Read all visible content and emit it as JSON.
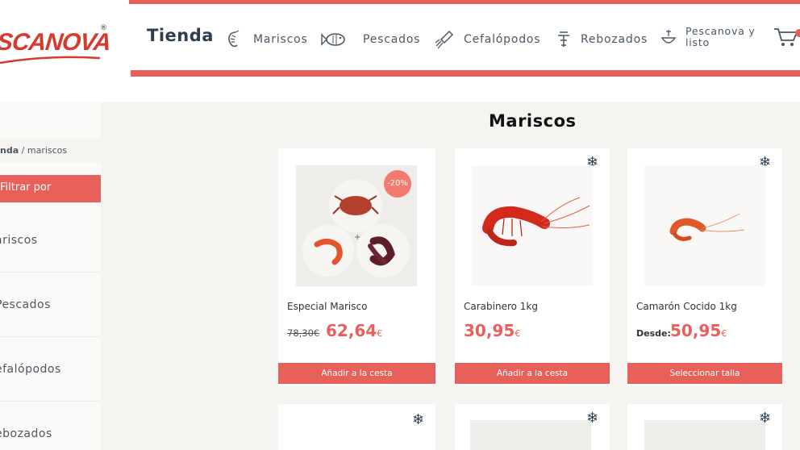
{
  "brand": {
    "logo_text": "SCANOVA",
    "reg": "®"
  },
  "nav": {
    "title": "Tienda",
    "items": [
      {
        "label": "Mariscos",
        "icon": "shrimp-icon"
      },
      {
        "label": "Pescados",
        "icon": "fish-icon"
      },
      {
        "label": "Cefalópodos",
        "icon": "squid-icon"
      },
      {
        "label": "Rebozados",
        "icon": "fried-food-icon"
      },
      {
        "label_line1": "Pescanova y",
        "label_line2": "listo",
        "icon": "dish-icon"
      }
    ],
    "cart_icon": "cart-icon"
  },
  "breadcrumb": {
    "home": "nda",
    "separator": "/",
    "current": "mariscos"
  },
  "filter": {
    "label": "Filtrar por"
  },
  "sidebar": {
    "items": [
      {
        "label": "ariscos"
      },
      {
        "label": "Pescados"
      },
      {
        "label": "efalópodos"
      },
      {
        "label": "ebozados"
      }
    ]
  },
  "section_title": "Mariscos",
  "products": [
    {
      "name": "Especial Marisco",
      "old_price": "78,30€",
      "price": "62,64",
      "currency": "€",
      "badge": "-20%",
      "button": "Añadir a la cesta",
      "frozen": false
    },
    {
      "name": "Carabinero 1kg",
      "price": "30,95",
      "currency": "€",
      "button": "Añadir a la cesta",
      "frozen": true
    },
    {
      "name": "Camarón Cocido 1kg",
      "from_label": "Desde:",
      "price": "50,95",
      "currency": "€",
      "button": "Seleccionar talla",
      "frozen": true
    }
  ],
  "colors": {
    "accent": "#e8605a",
    "brand_red": "#d63a2f",
    "text_dark": "#2c3e50",
    "bg_content": "#f5f4f1"
  },
  "icons": {
    "snowflake": "❄"
  }
}
